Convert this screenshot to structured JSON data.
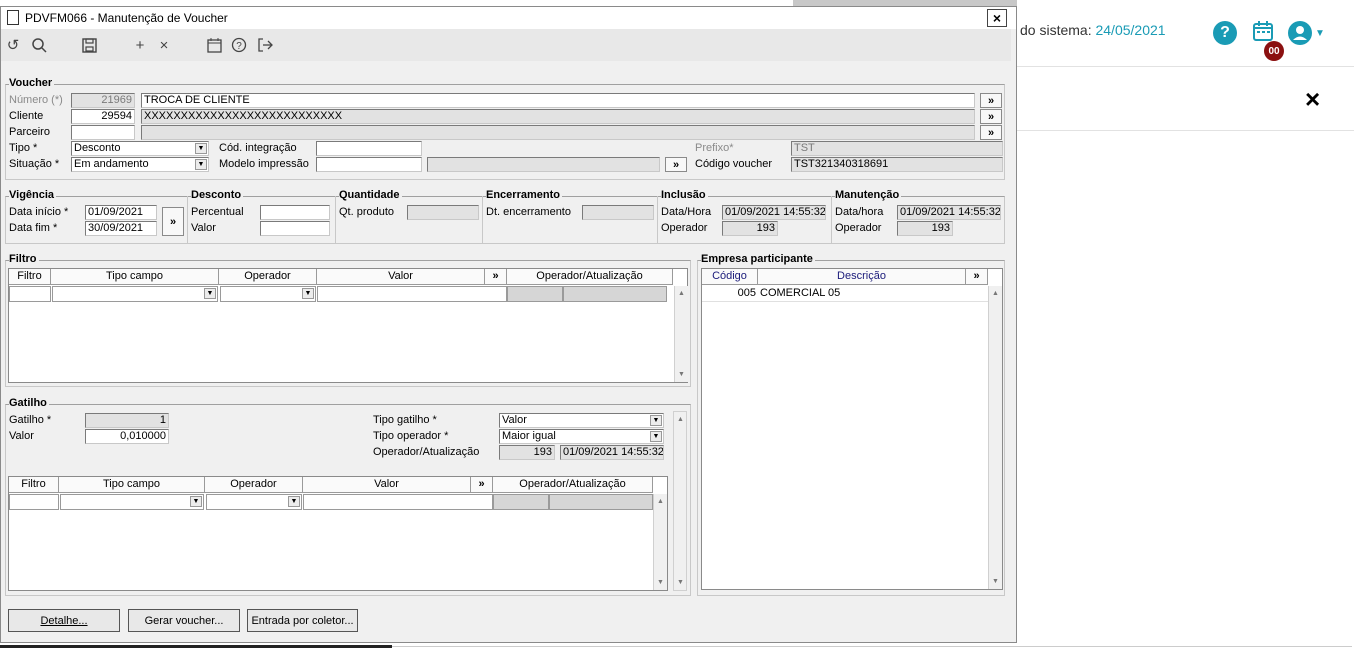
{
  "app": {
    "system_date_label": "do sistema:",
    "system_date": "24/05/2021",
    "help_icon": "question-circle-icon",
    "calendar_badge": "00",
    "close_glyph": "×"
  },
  "dialog": {
    "title": "PDVFM066 - Manutenção de Voucher",
    "close_glyph": "×"
  },
  "toolbar": {
    "undo": "↺",
    "search": "⌕",
    "save": "💾",
    "add": "+",
    "remove": "×",
    "calendar": "📅",
    "help": "?",
    "exit": "⇥"
  },
  "voucher": {
    "group_title": "Voucher",
    "numero_label": "Número (*)",
    "numero": "21969",
    "numero_desc": "TROCA DE CLIENTE",
    "cliente_label": "Cliente",
    "cliente": "29594",
    "cliente_desc": "XXXXXXXXXXXXXXXXXXXXXXXXXXX",
    "parceiro_label": "Parceiro",
    "parceiro": "",
    "tipo_label": "Tipo *",
    "tipo": "Desconto",
    "situacao_label": "Situação *",
    "situacao": "Em andamento",
    "cod_integracao_label": "Cód. integração",
    "cod_integracao": "",
    "modelo_impressao_label": "Modelo impressão",
    "modelo_impressao": "",
    "prefixo_label": "Prefixo*",
    "prefixo": "TST",
    "codigo_voucher_label": "Código voucher",
    "codigo_voucher": "TST321340318691",
    "more_glyph": "»"
  },
  "vigencia": {
    "group_title": "Vigência",
    "data_inicio_label": "Data início *",
    "data_inicio": "01/09/2021",
    "data_fim_label": "Data fim *",
    "data_fim": "30/09/2021"
  },
  "desconto": {
    "group_title": "Desconto",
    "percentual_label": "Percentual",
    "valor_label": "Valor"
  },
  "quantidade": {
    "group_title": "Quantidade",
    "qt_produto_label": "Qt. produto"
  },
  "encerramento": {
    "group_title": "Encerramento",
    "dt_label": "Dt. encerramento"
  },
  "inclusao": {
    "group_title": "Inclusão",
    "data_hora_label": "Data/Hora",
    "data_hora": "01/09/2021 14:55:32",
    "operador_label": "Operador",
    "operador": "193"
  },
  "manutencao": {
    "group_title": "Manutenção",
    "data_hora_label": "Data/hora",
    "data_hora": "01/09/2021 14:55:32",
    "operador_label": "Operador",
    "operador": "193"
  },
  "filtro": {
    "group_title": "Filtro",
    "columns": [
      "Filtro",
      "Tipo campo",
      "Operador",
      "Valor",
      "»",
      "Operador/Atualização"
    ]
  },
  "gatilho": {
    "group_title": "Gatilho",
    "gatilho_label": "Gatilho *",
    "gatilho": "1",
    "valor_label": "Valor",
    "valor": "0,010000",
    "tipo_gatilho_label": "Tipo gatilho *",
    "tipo_gatilho": "Valor",
    "tipo_operador_label": "Tipo operador *",
    "tipo_operador": "Maior igual",
    "op_atual_label": "Operador/Atualização",
    "op_atual_operador": "193",
    "op_atual_data": "01/09/2021 14:55:32",
    "columns": [
      "Filtro",
      "Tipo campo",
      "Operador",
      "Valor",
      "»",
      "Operador/Atualização"
    ]
  },
  "empresa": {
    "group_title": "Empresa participante",
    "columns": [
      "Código",
      "Descrição",
      "»"
    ],
    "rows": [
      {
        "codigo": "005",
        "descricao": "COMERCIAL 05"
      }
    ]
  },
  "buttons": {
    "detalhe": "Detalhe...",
    "gerar_voucher": "Gerar voucher...",
    "entrada_coletor": "Entrada por coletor..."
  }
}
